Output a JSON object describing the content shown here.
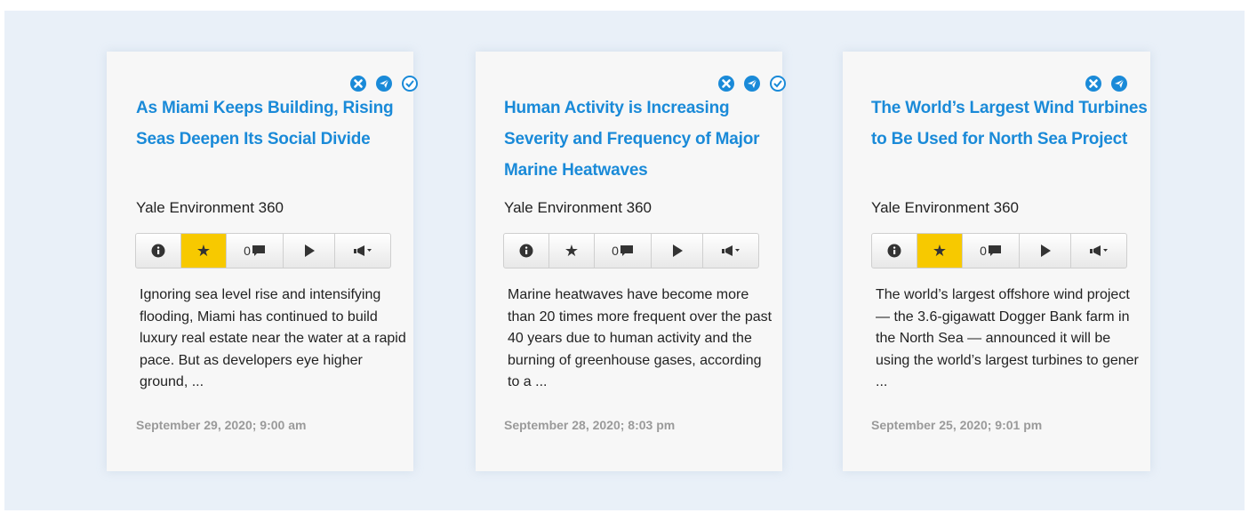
{
  "colors": {
    "accent_blue": "#1a8ad8",
    "star_active": "#f7c900",
    "background": "#e9f0f8"
  },
  "icons": {
    "close": "close-icon",
    "share": "share-icon",
    "check": "check-icon",
    "info": "info-icon",
    "star": "star-icon",
    "comment": "comment-icon",
    "play": "play-icon",
    "megaphone": "megaphone-icon"
  },
  "cards": [
    {
      "title": "As Miami Keeps Building, Rising Seas Deepen Its Social Divide",
      "source": "Yale Environment 360",
      "starred": true,
      "comment_count": "0",
      "summary": "Ignoring sea level rise and intensifying flooding, Miami has continued to build luxury real estate near the water at a rapid pace. But as developers eye higher ground, ...",
      "date": "September 29, 2020; 9:00 am"
    },
    {
      "title": "Human Activity is Increasing Severity and Frequency of Major Marine Heatwaves",
      "source": "Yale Environment 360",
      "starred": false,
      "comment_count": "0",
      "summary": "Marine heatwaves have become more than 20 times more frequent over the past 40 years due to human activity and the burning of greenhouse gases, according to a ...",
      "date": "September 28, 2020; 8:03 pm"
    },
    {
      "title": "The World’s Largest Wind Turbines to Be Used for North Sea Project",
      "source": "Yale Environment 360",
      "starred": true,
      "comment_count": "0",
      "summary": "The world’s largest offshore wind project — the 3.6-gigawatt Dogger Bank farm in the North Sea — announced it will be using the world’s largest turbines to gener ...",
      "date": "September 25, 2020; 9:01 pm"
    }
  ]
}
